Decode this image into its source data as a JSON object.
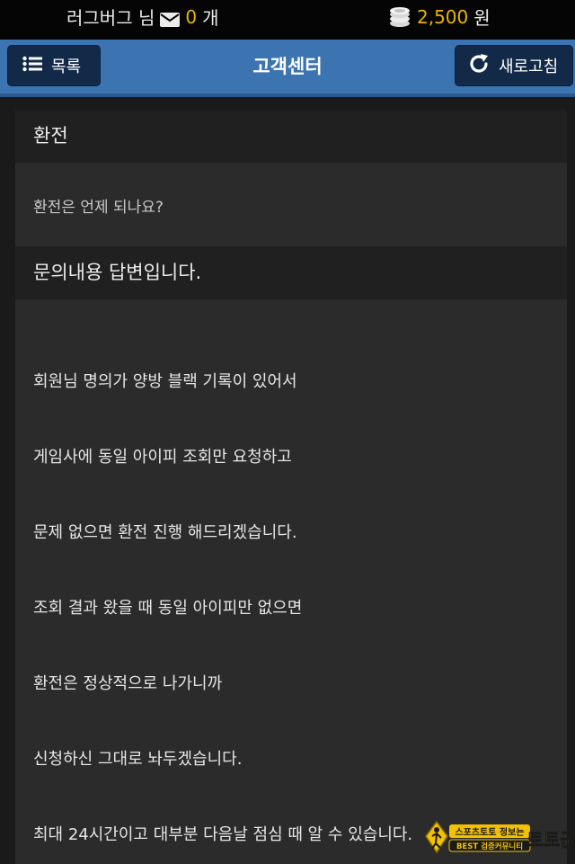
{
  "status": {
    "username": "러그버그 님",
    "message_count": "0",
    "message_unit": "개",
    "points": "2,500",
    "points_unit": "원"
  },
  "header": {
    "title": "고객센터",
    "list_label": "목록",
    "refresh_label": "새로고침"
  },
  "inquiry": {
    "category": "환전",
    "question": "환전은 언제 되나요?",
    "answer_title": "문의내용 답변입니다.",
    "answer_lines": [
      "회원님 명의가 양방 블랙 기록이 있어서",
      "게임사에 동일 아이피 조회만 요청하고",
      "문제 없으면 환전 진행 해드리겠습니다.",
      "조회 결과 왔을 때 동일 아이피만 없으면",
      "환전은 정상적으로 나가니까",
      "신청하신 그대로 놔두겠습니다.",
      "최대 24시간이고 대부분 다음날 점심 때 알 수 있습니다."
    ]
  },
  "watermark": {
    "brand": "토토군",
    "line1": "스포츠토토 정보는",
    "line2": "BEST 검증커뮤니티"
  },
  "colors": {
    "accent": "#3c74b2",
    "highlight": "#e8b400"
  }
}
